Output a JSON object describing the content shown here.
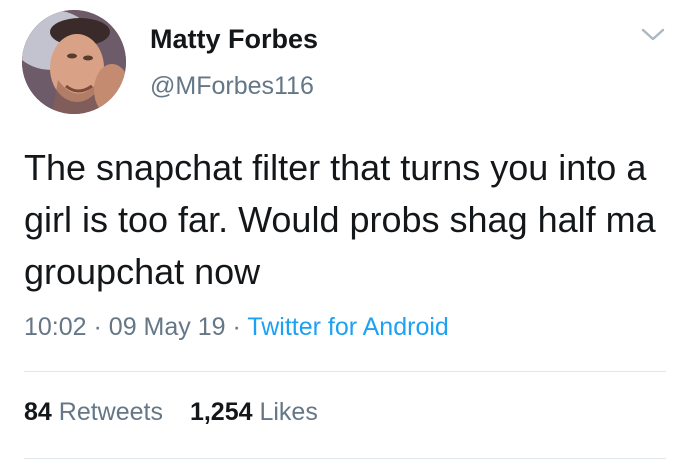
{
  "author": {
    "display_name": "Matty Forbes",
    "handle": "@MForbes116"
  },
  "icons": {
    "menu": "chevron-down-icon",
    "avatar": "profile-photo"
  },
  "tweet": {
    "text": "The snapchat filter that turns you into a girl is too far. Would probs shag half ma groupchat now",
    "time": "10:02",
    "separator": "·",
    "date": "09 May 19",
    "source": "Twitter for Android"
  },
  "stats": {
    "retweets_count": "84",
    "retweets_label": "Retweets",
    "likes_count": "1,254",
    "likes_label": "Likes"
  },
  "colors": {
    "text": "#14171a",
    "secondary": "#657786",
    "link": "#1da1f2",
    "divider": "#e1e8ed"
  }
}
